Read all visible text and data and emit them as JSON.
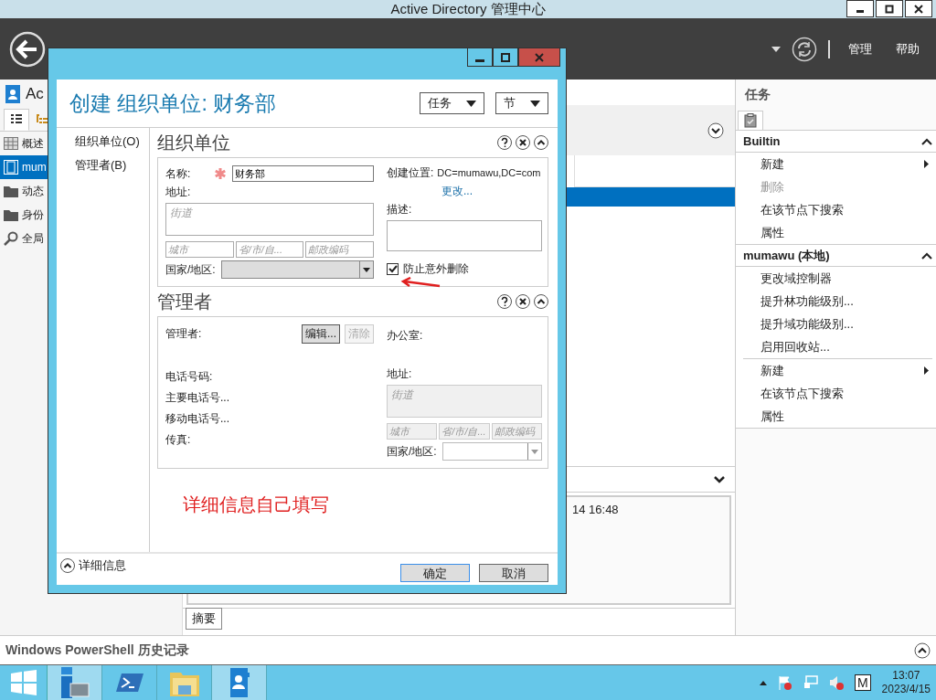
{
  "window": {
    "title": "Active Directory 管理中心"
  },
  "header": {
    "menu": [
      "管理",
      "帮助"
    ]
  },
  "navigation": {
    "title": "Ac",
    "items": [
      {
        "label": "概述",
        "kind": "overview",
        "selected": false
      },
      {
        "label": "mum",
        "kind": "domain",
        "selected": true
      },
      {
        "label": "动态",
        "kind": "folder",
        "selected": false
      },
      {
        "label": "身份",
        "kind": "folder",
        "selected": false
      },
      {
        "label": "全局",
        "kind": "search",
        "selected": false
      }
    ]
  },
  "content": {
    "timestamp": "14 16:48",
    "tabs": [
      {
        "label": "摘要",
        "selected": true
      }
    ]
  },
  "tasks": {
    "title": "任务",
    "sections": [
      {
        "title": "Builtin",
        "expanded": true,
        "groups": [
          [
            {
              "label": "新建",
              "submenu": true,
              "disabled": false
            },
            {
              "label": "删除",
              "submenu": false,
              "disabled": true
            },
            {
              "label": "在该节点下搜索",
              "submenu": false,
              "disabled": false
            },
            {
              "label": "属性",
              "submenu": false,
              "disabled": false
            }
          ]
        ]
      },
      {
        "title": "mumawu (本地)",
        "expanded": true,
        "groups": [
          [
            {
              "label": "更改域控制器",
              "submenu": false,
              "disabled": false
            },
            {
              "label": "提升林功能级别...",
              "submenu": false,
              "disabled": false
            },
            {
              "label": "提升域功能级别...",
              "submenu": false,
              "disabled": false
            },
            {
              "label": "启用回收站...",
              "submenu": false,
              "disabled": false
            }
          ],
          [
            {
              "label": "新建",
              "submenu": true,
              "disabled": false
            },
            {
              "label": "在该节点下搜索",
              "submenu": false,
              "disabled": false
            },
            {
              "label": "属性",
              "submenu": false,
              "disabled": false
            }
          ]
        ]
      }
    ]
  },
  "powershell_history": {
    "title": "Windows PowerShell 历史记录",
    "expanded": false
  },
  "taskbar": {
    "apps": [
      {
        "kind": "server-manager",
        "active": true
      },
      {
        "kind": "powershell",
        "active": false
      },
      {
        "kind": "explorer",
        "active": false
      },
      {
        "kind": "directory",
        "active": true
      }
    ],
    "ime": "M",
    "time": "13:07",
    "date": "2023/4/15"
  },
  "dialog": {
    "title": "创建 组织单位: 财务部",
    "menus": [
      "任务",
      "节"
    ],
    "nav": [
      "组织单位(O)",
      "管理者(B)"
    ],
    "ou": {
      "heading": "组织单位",
      "name_label": "名称:",
      "name": "财务部",
      "address_label": "地址:",
      "street": {
        "placeholder": "街道"
      },
      "city": {
        "placeholder": "城市"
      },
      "province": {
        "placeholder": "省/市/自..."
      },
      "postal": {
        "placeholder": "邮政编码"
      },
      "country_label": "国家/地区:",
      "location_label": "创建位置:",
      "location": "DC=mumawu,DC=com",
      "change_link": "更改...",
      "description_label": "描述:",
      "protect_label": "防止意外删除",
      "protect_checked": true
    },
    "manager": {
      "heading": "管理者",
      "manager_label": "管理者:",
      "edit_button": "编辑...",
      "clear_button": "清除",
      "clear_disabled": true,
      "office_label": "办公室:",
      "phone_label": "电话号码:",
      "main_phone": "主要电话号...",
      "mobile_phone": "移动电话号...",
      "fax_label": "传真:",
      "address_label": "地址:",
      "street": {
        "placeholder": "街道"
      },
      "city": {
        "placeholder": "城市"
      },
      "province": {
        "placeholder": "省/市/自..."
      },
      "postal": {
        "placeholder": "邮政编码"
      },
      "country_label": "国家/地区:"
    },
    "annotation": "详细信息自己填写",
    "details": "详细信息",
    "buttons": [
      {
        "label": "确定",
        "default": true
      },
      {
        "label": "取消",
        "default": false
      }
    ]
  }
}
